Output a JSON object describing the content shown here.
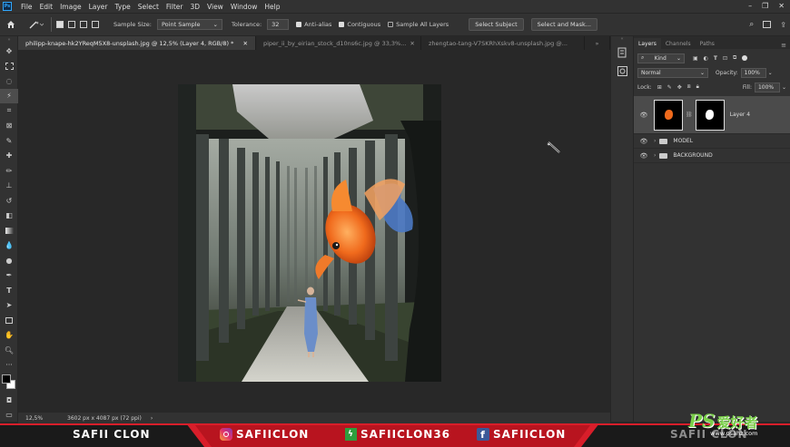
{
  "menubar": {
    "logo": "Ps",
    "items": [
      "File",
      "Edit",
      "Image",
      "Layer",
      "Type",
      "Select",
      "Filter",
      "3D",
      "View",
      "Window",
      "Help"
    ]
  },
  "options": {
    "sample_size_label": "Sample Size:",
    "sample_size_value": "Point Sample",
    "tolerance_label": "Tolerance:",
    "tolerance_value": "32",
    "anti_alias": "Anti-alias",
    "contiguous": "Contiguous",
    "sample_all": "Sample All Layers",
    "select_subject": "Select Subject",
    "select_mask": "Select and Mask..."
  },
  "tabs": [
    "philipp-knape-hk2YReqM5X8-unsplash.jpg @ 12,5% (Layer 4, RGB/8) *",
    "piper_ii_by_eirian_stock_d10ns6c.jpg @ 33,3%...",
    "zhengtao-tang-V7SKRhXskv8-unsplash.jpg @..."
  ],
  "status": {
    "zoom": "12,5%",
    "doc": "3602 px x 4087 px (72 ppi)"
  },
  "layers_panel": {
    "tabs": [
      "Layers",
      "Channels",
      "Paths"
    ],
    "kind": "Kind",
    "blend_mode": "Normal",
    "opacity_label": "Opacity:",
    "opacity_value": "100%",
    "lock_label": "Lock:",
    "fill_label": "Fill:",
    "fill_value": "100%",
    "layers": [
      {
        "name": "Layer 4"
      },
      {
        "name": "MODEL"
      },
      {
        "name": "BACKGROUND"
      }
    ]
  },
  "banner": {
    "left": "SAFII CLON",
    "instagram": "SAFIICLON",
    "web": "SAFIICLON36",
    "facebook": "SAFIICLON",
    "right": "SAFII CLON",
    "watermark_ps": "PS",
    "watermark_cn": "爱好者",
    "watermark_url": "www.psahz.com"
  },
  "colors": {
    "accent_red": "#d81e2a",
    "fish_orange": "#f06a1c",
    "ps_blue": "#31a8ff"
  }
}
